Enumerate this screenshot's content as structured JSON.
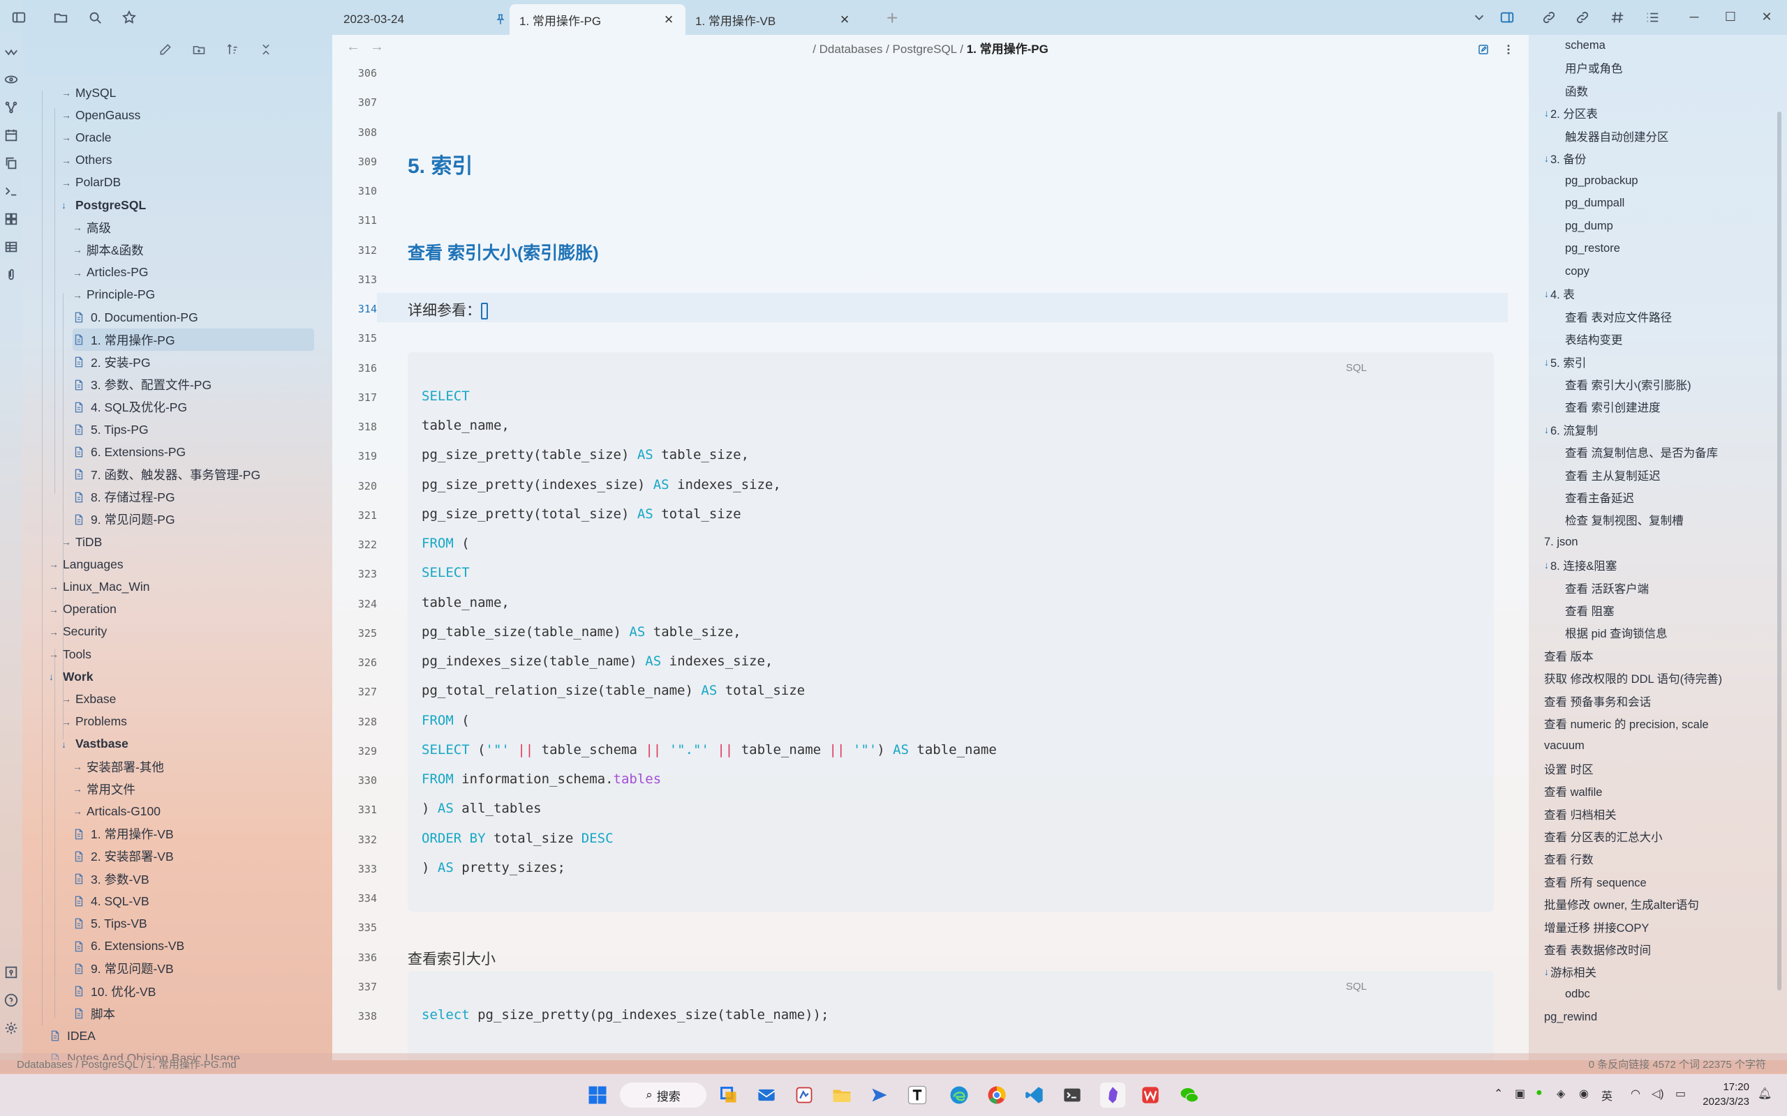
{
  "tabs": [
    {
      "label": "2023-03-24",
      "active": false,
      "closable": false
    },
    {
      "label": "1. 常用操作-PG",
      "active": true,
      "pinned": true
    },
    {
      "label": "1. 常用操作-VB",
      "active": false
    }
  ],
  "breadcrumb": {
    "path": "/ Ddatabases / PostgreSQL / ",
    "current": "1. 常用操作-PG"
  },
  "tree": [
    {
      "label": "MySQL",
      "depth": 1,
      "type": "folder"
    },
    {
      "label": "OpenGauss",
      "depth": 1,
      "type": "folder"
    },
    {
      "label": "Oracle",
      "depth": 1,
      "type": "folder"
    },
    {
      "label": "Others",
      "depth": 1,
      "type": "folder"
    },
    {
      "label": "PolarDB",
      "depth": 1,
      "type": "folder"
    },
    {
      "label": "PostgreSQL",
      "depth": 1,
      "type": "folder-open"
    },
    {
      "label": "高级",
      "depth": 2,
      "type": "folder"
    },
    {
      "label": "脚本&函数",
      "depth": 2,
      "type": "folder"
    },
    {
      "label": "Articles-PG",
      "depth": 2,
      "type": "folder"
    },
    {
      "label": "Principle-PG",
      "depth": 2,
      "type": "folder"
    },
    {
      "label": "0. Documention-PG",
      "depth": 2,
      "type": "doc"
    },
    {
      "label": "1. 常用操作-PG",
      "depth": 2,
      "type": "doc",
      "selected": true
    },
    {
      "label": "2. 安装-PG",
      "depth": 2,
      "type": "doc"
    },
    {
      "label": "3. 参数、配置文件-PG",
      "depth": 2,
      "type": "doc"
    },
    {
      "label": "4. SQL及优化-PG",
      "depth": 2,
      "type": "doc"
    },
    {
      "label": "5. Tips-PG",
      "depth": 2,
      "type": "doc"
    },
    {
      "label": "6. Extensions-PG",
      "depth": 2,
      "type": "doc"
    },
    {
      "label": "7. 函数、触发器、事务管理-PG",
      "depth": 2,
      "type": "doc"
    },
    {
      "label": "8. 存储过程-PG",
      "depth": 2,
      "type": "doc"
    },
    {
      "label": "9. 常见问题-PG",
      "depth": 2,
      "type": "doc"
    },
    {
      "label": "TiDB",
      "depth": 1,
      "type": "folder"
    },
    {
      "label": "Languages",
      "depth": 0,
      "type": "folder"
    },
    {
      "label": "Linux_Mac_Win",
      "depth": 0,
      "type": "folder"
    },
    {
      "label": "Operation",
      "depth": 0,
      "type": "folder"
    },
    {
      "label": "Security",
      "depth": 0,
      "type": "folder"
    },
    {
      "label": "Tools",
      "depth": 0,
      "type": "folder"
    },
    {
      "label": "Work",
      "depth": 0,
      "type": "folder-open"
    },
    {
      "label": "Exbase",
      "depth": 1,
      "type": "folder"
    },
    {
      "label": "Problems",
      "depth": 1,
      "type": "folder"
    },
    {
      "label": "Vastbase",
      "depth": 1,
      "type": "folder-open"
    },
    {
      "label": "安装部署-其他",
      "depth": 2,
      "type": "folder"
    },
    {
      "label": "常用文件",
      "depth": 2,
      "type": "folder"
    },
    {
      "label": "Articals-G100",
      "depth": 2,
      "type": "folder"
    },
    {
      "label": "1. 常用操作-VB",
      "depth": 2,
      "type": "doc"
    },
    {
      "label": "2. 安装部署-VB",
      "depth": 2,
      "type": "doc"
    },
    {
      "label": "3. 参数-VB",
      "depth": 2,
      "type": "doc"
    },
    {
      "label": "4. SQL-VB",
      "depth": 2,
      "type": "doc"
    },
    {
      "label": "5. Tips-VB",
      "depth": 2,
      "type": "doc"
    },
    {
      "label": "6. Extensions-VB",
      "depth": 2,
      "type": "doc"
    },
    {
      "label": "9. 常见问题-VB",
      "depth": 2,
      "type": "doc"
    },
    {
      "label": "10. 优化-VB",
      "depth": 2,
      "type": "doc"
    },
    {
      "label": "脚本",
      "depth": 2,
      "type": "doc"
    },
    {
      "label": "IDEA",
      "depth": 0,
      "type": "doc"
    },
    {
      "label": "Notes And Obision Basic Usage",
      "depth": 0,
      "type": "doc"
    }
  ],
  "editor_lines": [
    {
      "n": "306",
      "text": ""
    },
    {
      "n": "307",
      "text": ""
    },
    {
      "n": "308",
      "text": ""
    },
    {
      "n": "309",
      "text": "5. 索引",
      "style": "h2"
    },
    {
      "n": "310",
      "text": ""
    },
    {
      "n": "311",
      "text": ""
    },
    {
      "n": "312",
      "text": "查看 索引大小(索引膨胀)",
      "style": "h3"
    },
    {
      "n": "313",
      "text": ""
    },
    {
      "n": "314",
      "text": "详细参看：",
      "style": "current"
    },
    {
      "n": "315",
      "text": ""
    },
    {
      "n": "316",
      "text": ""
    },
    {
      "n": "317",
      "text": ""
    },
    {
      "n": "318",
      "text": ""
    },
    {
      "n": "319",
      "text": ""
    },
    {
      "n": "320",
      "text": ""
    },
    {
      "n": "321",
      "text": ""
    },
    {
      "n": "322",
      "text": ""
    },
    {
      "n": "323",
      "text": ""
    },
    {
      "n": "324",
      "text": ""
    },
    {
      "n": "325",
      "text": ""
    },
    {
      "n": "326",
      "text": ""
    },
    {
      "n": "327",
      "text": ""
    },
    {
      "n": "328",
      "text": ""
    },
    {
      "n": "329",
      "text": ""
    },
    {
      "n": "330",
      "text": ""
    },
    {
      "n": "331",
      "text": ""
    },
    {
      "n": "332",
      "text": ""
    },
    {
      "n": "333",
      "text": ""
    },
    {
      "n": "334",
      "text": ""
    },
    {
      "n": "335",
      "text": ""
    },
    {
      "n": "336",
      "text": "查看索引大小"
    },
    {
      "n": "337",
      "text": ""
    },
    {
      "n": "338",
      "text": ""
    }
  ],
  "code_block_1": {
    "lang": "SQL",
    "lines": [
      [
        {
          "t": "SELECT",
          "c": "kw"
        }
      ],
      [
        {
          "t": "table_name,"
        }
      ],
      [
        {
          "t": "pg_size_pretty(table_size) "
        },
        {
          "t": "AS",
          "c": "kw"
        },
        {
          "t": " table_size,"
        }
      ],
      [
        {
          "t": "pg_size_pretty(indexes_size) "
        },
        {
          "t": "AS",
          "c": "kw"
        },
        {
          "t": " indexes_size,"
        }
      ],
      [
        {
          "t": "pg_size_pretty(total_size) "
        },
        {
          "t": "AS",
          "c": "kw"
        },
        {
          "t": " total_size"
        }
      ],
      [
        {
          "t": "FROM",
          "c": "kw"
        },
        {
          "t": " ("
        }
      ],
      [
        {
          "t": "SELECT",
          "c": "kw"
        }
      ],
      [
        {
          "t": "table_name,"
        }
      ],
      [
        {
          "t": "pg_table_size(table_name) "
        },
        {
          "t": "AS",
          "c": "kw"
        },
        {
          "t": " table_size,"
        }
      ],
      [
        {
          "t": "pg_indexes_size(table_name) "
        },
        {
          "t": "AS",
          "c": "kw"
        },
        {
          "t": " indexes_size,"
        }
      ],
      [
        {
          "t": "pg_total_relation_size(table_name) "
        },
        {
          "t": "AS",
          "c": "kw"
        },
        {
          "t": " total_size"
        }
      ],
      [
        {
          "t": "FROM",
          "c": "kw"
        },
        {
          "t": " ("
        }
      ],
      [
        {
          "t": "SELECT",
          "c": "kw"
        },
        {
          "t": " ("
        },
        {
          "t": "'\"'",
          "c": "st"
        },
        {
          "t": " "
        },
        {
          "t": "||",
          "c": "op"
        },
        {
          "t": " table_schema "
        },
        {
          "t": "||",
          "c": "op"
        },
        {
          "t": " "
        },
        {
          "t": "'\".\"'",
          "c": "st"
        },
        {
          "t": " "
        },
        {
          "t": "||",
          "c": "op"
        },
        {
          "t": " table_name "
        },
        {
          "t": "||",
          "c": "op"
        },
        {
          "t": " "
        },
        {
          "t": "'\"'",
          "c": "st"
        },
        {
          "t": ") "
        },
        {
          "t": "AS",
          "c": "kw"
        },
        {
          "t": " table_name"
        }
      ],
      [
        {
          "t": "FROM",
          "c": "kw"
        },
        {
          "t": " information_schema."
        },
        {
          "t": "tables",
          "c": "pu"
        }
      ],
      [
        {
          "t": ") "
        },
        {
          "t": "AS",
          "c": "kw"
        },
        {
          "t": " all_tables"
        }
      ],
      [
        {
          "t": "ORDER BY",
          "c": "kw"
        },
        {
          "t": " total_size "
        },
        {
          "t": "DESC",
          "c": "kw"
        }
      ],
      [
        {
          "t": ") "
        },
        {
          "t": "AS",
          "c": "kw"
        },
        {
          "t": " pretty_sizes;"
        }
      ]
    ]
  },
  "code_block_2": {
    "lang": "SQL",
    "lines": [
      [
        {
          "t": "select",
          "c": "kw"
        },
        {
          "t": " pg_size_pretty(pg_indexes_size(table_name));"
        }
      ]
    ]
  },
  "outline": [
    {
      "label": "schema",
      "indent": 1
    },
    {
      "label": "用户或角色",
      "indent": 1
    },
    {
      "label": "函数",
      "indent": 1
    },
    {
      "label": "2. 分区表",
      "indent": 0,
      "open": true
    },
    {
      "label": "触发器自动创建分区",
      "indent": 1
    },
    {
      "label": "3. 备份",
      "indent": 0,
      "open": true
    },
    {
      "label": "pg_probackup",
      "indent": 1
    },
    {
      "label": "pg_dumpall",
      "indent": 1
    },
    {
      "label": "pg_dump",
      "indent": 1
    },
    {
      "label": "pg_restore",
      "indent": 1
    },
    {
      "label": "copy",
      "indent": 1
    },
    {
      "label": "4. 表",
      "indent": 0,
      "open": true
    },
    {
      "label": "查看 表对应文件路径",
      "indent": 1
    },
    {
      "label": "表结构变更",
      "indent": 1
    },
    {
      "label": "5. 索引",
      "indent": 0,
      "open": true
    },
    {
      "label": "查看 索引大小(索引膨胀)",
      "indent": 1
    },
    {
      "label": "查看 索引创建进度",
      "indent": 1
    },
    {
      "label": "6. 流复制",
      "indent": 0,
      "open": true
    },
    {
      "label": "查看 流复制信息、是否为备库",
      "indent": 1
    },
    {
      "label": "查看 主从复制延迟",
      "indent": 1
    },
    {
      "label": "查看主备延迟",
      "indent": 1
    },
    {
      "label": "检查 复制视图、复制槽",
      "indent": 1
    },
    {
      "label": "7. json",
      "indent": 0
    },
    {
      "label": "8. 连接&阻塞",
      "indent": 0,
      "open": true
    },
    {
      "label": "查看 活跃客户端",
      "indent": 1
    },
    {
      "label": "查看 阻塞",
      "indent": 1
    },
    {
      "label": "根据 pid 查询锁信息",
      "indent": 1
    },
    {
      "label": "查看 版本",
      "indent": 0
    },
    {
      "label": "获取 修改权限的 DDL 语句(待完善)",
      "indent": 0
    },
    {
      "label": "查看 预备事务和会话",
      "indent": 0
    },
    {
      "label": "查看 numeric 的 precision, scale",
      "indent": 0
    },
    {
      "label": "vacuum",
      "indent": 0
    },
    {
      "label": "设置 时区",
      "indent": 0
    },
    {
      "label": "查看 walfile",
      "indent": 0
    },
    {
      "label": "查看 归档相关",
      "indent": 0
    },
    {
      "label": "查看 分区表的汇总大小",
      "indent": 0
    },
    {
      "label": "查看 行数",
      "indent": 0
    },
    {
      "label": "查看 所有 sequence",
      "indent": 0
    },
    {
      "label": "批量修改 owner, 生成alter语句",
      "indent": 0
    },
    {
      "label": "增量迁移 拼接COPY",
      "indent": 0
    },
    {
      "label": "查看 表数据修改时间",
      "indent": 0
    },
    {
      "label": "游标相关",
      "indent": 0,
      "open": true
    },
    {
      "label": "odbc",
      "indent": 1
    },
    {
      "label": "pg_rewind",
      "indent": 0
    }
  ],
  "statusbar": {
    "path": "Ddatabases / PostgreSQL / 1. 常用操作-PG.md",
    "right": "0 条反向链接   4572 个词  22375 个字符"
  },
  "taskbar": {
    "search_label": "搜索",
    "ime": "英",
    "time": "17:20",
    "date": "2023/3/23"
  },
  "colors": {
    "accent": "#1f73b7",
    "keyword": "#16a7c6",
    "operator": "#e0365b",
    "property": "#a24fd6"
  }
}
